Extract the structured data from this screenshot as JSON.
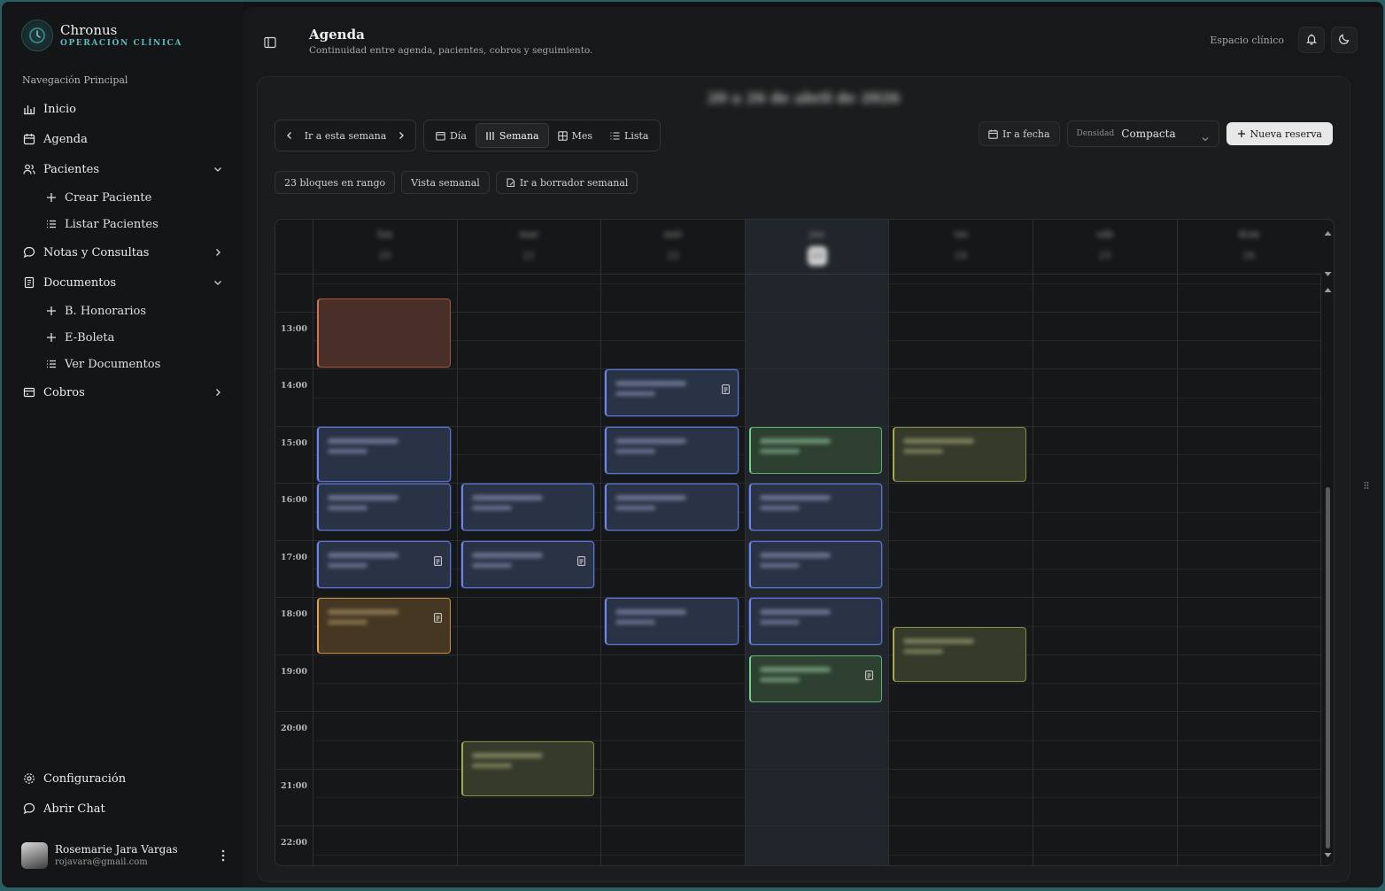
{
  "app": {
    "name": "Chronus",
    "subtitle": "OPERACIÓN CLÍNICA"
  },
  "sidebar": {
    "section_title": "Navegación Principal",
    "items": [
      {
        "label": "Inicio",
        "icon": "chart-icon"
      },
      {
        "label": "Agenda",
        "icon": "calendar-icon"
      },
      {
        "label": "Pacientes",
        "icon": "users-icon",
        "expanded": true,
        "children": [
          {
            "label": "Crear Paciente",
            "icon": "plus-icon"
          },
          {
            "label": "Listar Pacientes",
            "icon": "list-icon"
          }
        ]
      },
      {
        "label": "Notas y Consultas",
        "icon": "chat-icon",
        "expanded": false
      },
      {
        "label": "Documentos",
        "icon": "document-icon",
        "expanded": true,
        "children": [
          {
            "label": "B. Honorarios",
            "icon": "plus-icon"
          },
          {
            "label": "E-Boleta",
            "icon": "plus-icon"
          },
          {
            "label": "Ver Documentos",
            "icon": "list-icon"
          }
        ]
      },
      {
        "label": "Cobros",
        "icon": "card-icon",
        "expanded": false
      }
    ],
    "bottom_items": [
      {
        "label": "Configuración",
        "icon": "gear-icon"
      },
      {
        "label": "Abrir Chat",
        "icon": "chat-icon"
      }
    ],
    "user": {
      "name": "Rosemarie Jara Vargas",
      "email": "rojavara@gmail.com"
    }
  },
  "header": {
    "title": "Agenda",
    "subtitle": "Continuidad entre agenda, pacientes, cobros y seguimiento.",
    "workspace": "Espacio clínico"
  },
  "toolbar": {
    "week_title": "20 a 26 de abril de 2026",
    "go_this_week": "Ir a esta semana",
    "views": [
      {
        "label": "Día",
        "icon": "day-icon",
        "active": false
      },
      {
        "label": "Semana",
        "icon": "week-icon",
        "active": true
      },
      {
        "label": "Mes",
        "icon": "month-icon",
        "active": false
      },
      {
        "label": "Lista",
        "icon": "list-icon",
        "active": false
      }
    ],
    "go_date": "Ir a fecha",
    "density_label": "Densidad",
    "density_value": "Compacta",
    "new_booking": "Nueva reserva"
  },
  "chips": [
    {
      "label": "23 bloques en rango",
      "icon": null
    },
    {
      "label": "Vista semanal",
      "icon": null
    },
    {
      "label": "Ir a borrador semanal",
      "icon": "draft-icon"
    }
  ],
  "calendar": {
    "days": [
      {
        "name": "lun",
        "num": "20",
        "today": false
      },
      {
        "name": "mar",
        "num": "21",
        "today": false
      },
      {
        "name": "mié",
        "num": "22",
        "today": false
      },
      {
        "name": "jue",
        "num": "23",
        "today": true
      },
      {
        "name": "vie",
        "num": "24",
        "today": false
      },
      {
        "name": "sáb",
        "num": "25",
        "today": false
      },
      {
        "name": "dom",
        "num": "26",
        "today": false
      }
    ],
    "hours": [
      "13:00",
      "14:00",
      "15:00",
      "16:00",
      "17:00",
      "18:00",
      "19:00",
      "20:00",
      "21:00",
      "22:00"
    ],
    "events": [
      {
        "day": 0,
        "start": 12.75,
        "end": 14.0,
        "color": "orange",
        "doc": false
      },
      {
        "day": 0,
        "start": 15.0,
        "end": 16.0,
        "color": "blue",
        "doc": false
      },
      {
        "day": 0,
        "start": 16.0,
        "end": 16.85,
        "color": "blue",
        "doc": false
      },
      {
        "day": 0,
        "start": 17.0,
        "end": 17.85,
        "color": "blue",
        "doc": true
      },
      {
        "day": 0,
        "start": 18.0,
        "end": 19.0,
        "color": "amber",
        "doc": true
      },
      {
        "day": 1,
        "start": 16.0,
        "end": 16.85,
        "color": "blue",
        "doc": false
      },
      {
        "day": 1,
        "start": 17.0,
        "end": 17.85,
        "color": "blue",
        "doc": true
      },
      {
        "day": 1,
        "start": 20.5,
        "end": 21.5,
        "color": "olive",
        "doc": false
      },
      {
        "day": 2,
        "start": 14.0,
        "end": 14.85,
        "color": "blue",
        "doc": true
      },
      {
        "day": 2,
        "start": 15.0,
        "end": 15.85,
        "color": "blue",
        "doc": false
      },
      {
        "day": 2,
        "start": 16.0,
        "end": 16.85,
        "color": "blue",
        "doc": false
      },
      {
        "day": 2,
        "start": 18.0,
        "end": 18.85,
        "color": "blue",
        "doc": false
      },
      {
        "day": 3,
        "start": 15.0,
        "end": 15.85,
        "color": "green",
        "doc": false
      },
      {
        "day": 3,
        "start": 16.0,
        "end": 16.85,
        "color": "blue",
        "doc": false
      },
      {
        "day": 3,
        "start": 17.0,
        "end": 17.85,
        "color": "blue",
        "doc": false
      },
      {
        "day": 3,
        "start": 18.0,
        "end": 18.85,
        "color": "blue",
        "doc": false
      },
      {
        "day": 3,
        "start": 19.0,
        "end": 19.85,
        "color": "green",
        "doc": true
      },
      {
        "day": 4,
        "start": 15.0,
        "end": 16.0,
        "color": "olive",
        "doc": false
      },
      {
        "day": 4,
        "start": 18.5,
        "end": 19.5,
        "color": "olive",
        "doc": false
      }
    ]
  }
}
